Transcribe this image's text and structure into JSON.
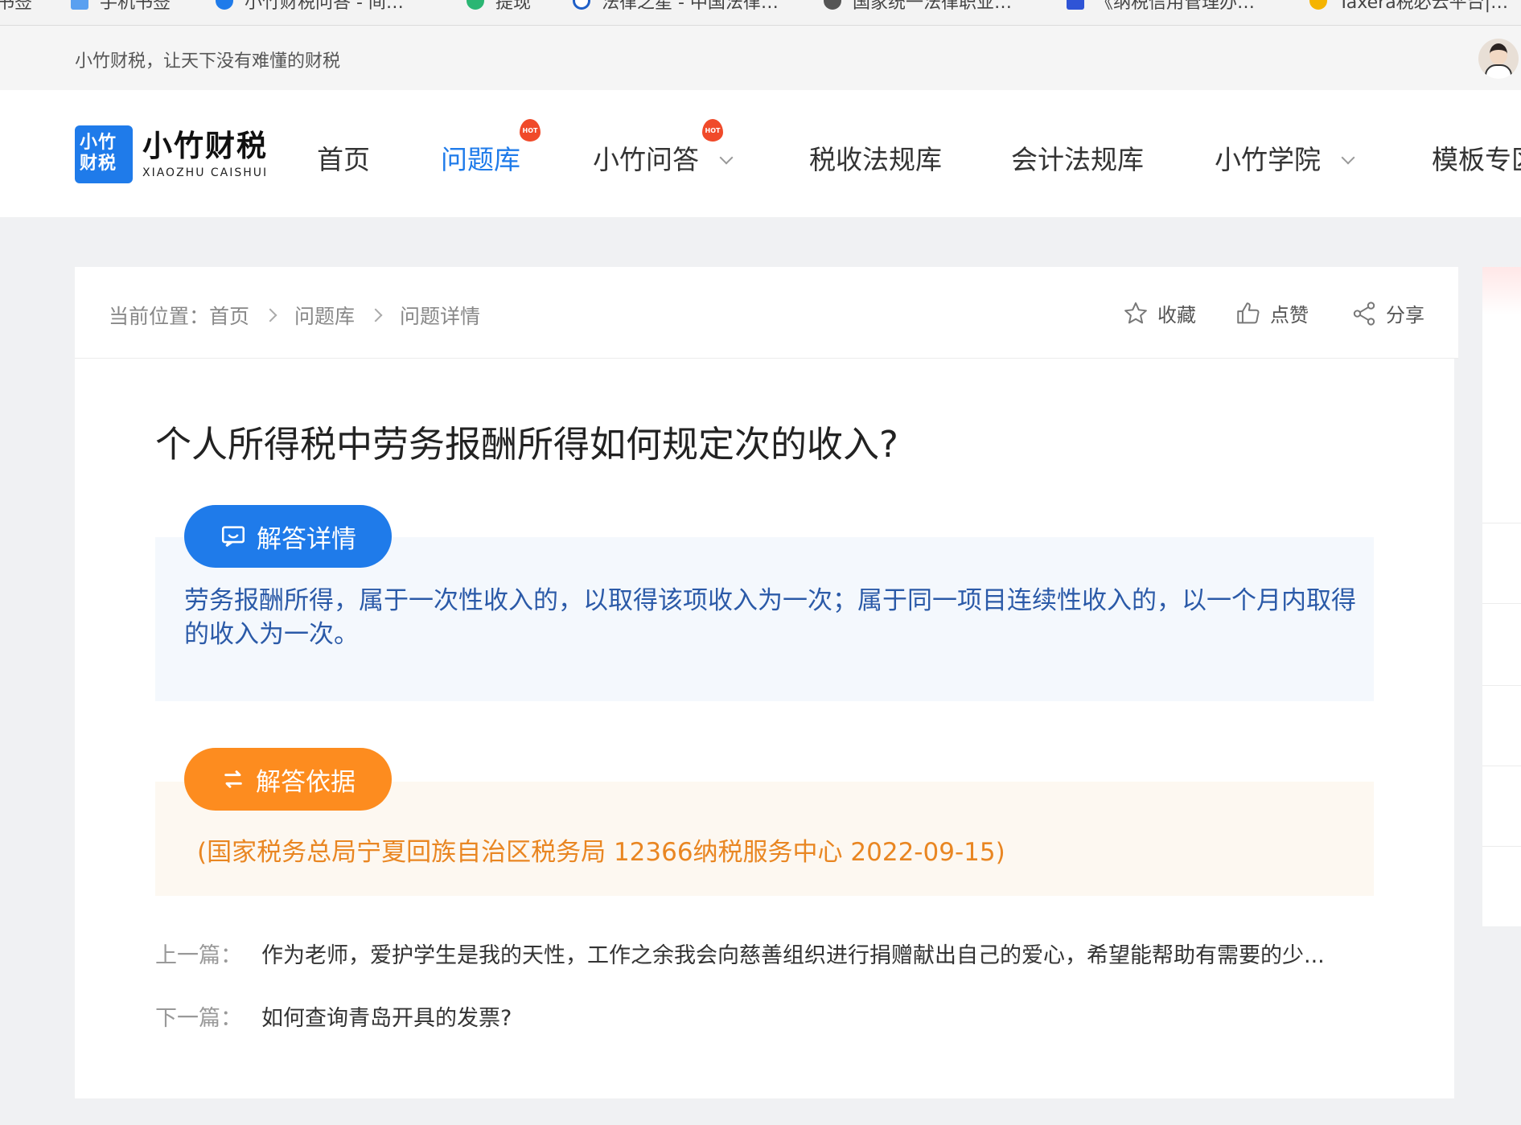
{
  "bookmarks": [
    {
      "label": "书签"
    },
    {
      "label": "手机书签"
    },
    {
      "label": "小竹财税问答 - 间…"
    },
    {
      "label": "提现"
    },
    {
      "label": "法律之星 - 中国法律…"
    },
    {
      "label": "国家统一法律职业…"
    },
    {
      "label": "《纳税信用管理办…"
    },
    {
      "label": "Taxera税必云平台|…"
    }
  ],
  "topbar": {
    "slogan": "小竹财税，让天下没有难懂的财税"
  },
  "logo": {
    "mark": "小竹财税",
    "cn": "小竹财税",
    "en": "XIAOZHU CAISHUI"
  },
  "nav": {
    "items": [
      {
        "label": "首页"
      },
      {
        "label": "问题库",
        "badge": "HOT"
      },
      {
        "label": "小竹问答",
        "badge": "HOT"
      },
      {
        "label": "税收法规库"
      },
      {
        "label": "会计法规库"
      },
      {
        "label": "小竹学院"
      },
      {
        "label": "模板专区"
      }
    ]
  },
  "breadcrumb": {
    "prefix": "当前位置：",
    "items": [
      "首页",
      "问题库",
      "问题详情"
    ]
  },
  "actions": {
    "favorite": "收藏",
    "like": "点赞",
    "share": "分享"
  },
  "question": {
    "title": "个人所得税中劳务报酬所得如何规定次的收入?",
    "answer_label": "解答详情",
    "answer_text": "劳务报酬所得，属于一次性收入的，以取得该项收入为一次；属于同一项目连续性收入的，以一个月内取得的收入为一次。",
    "basis_label": "解答依据",
    "basis_text": "(国家税务总局宁夏回族自治区税务局 12366纳税服务中心 2022-09-15)"
  },
  "prev": {
    "label": "上一篇：",
    "text": "作为老师，爱护学生是我的天性，工作之余我会向慈善组织进行捐赠献出自己的爱心，希望能帮助有需要的少..."
  },
  "next": {
    "label": "下一篇：",
    "text": "如何查询青岛开具的发票?"
  },
  "colors": {
    "primary": "#1f7bea",
    "accent": "#fd8c1f",
    "hot": "#f04a2a"
  }
}
